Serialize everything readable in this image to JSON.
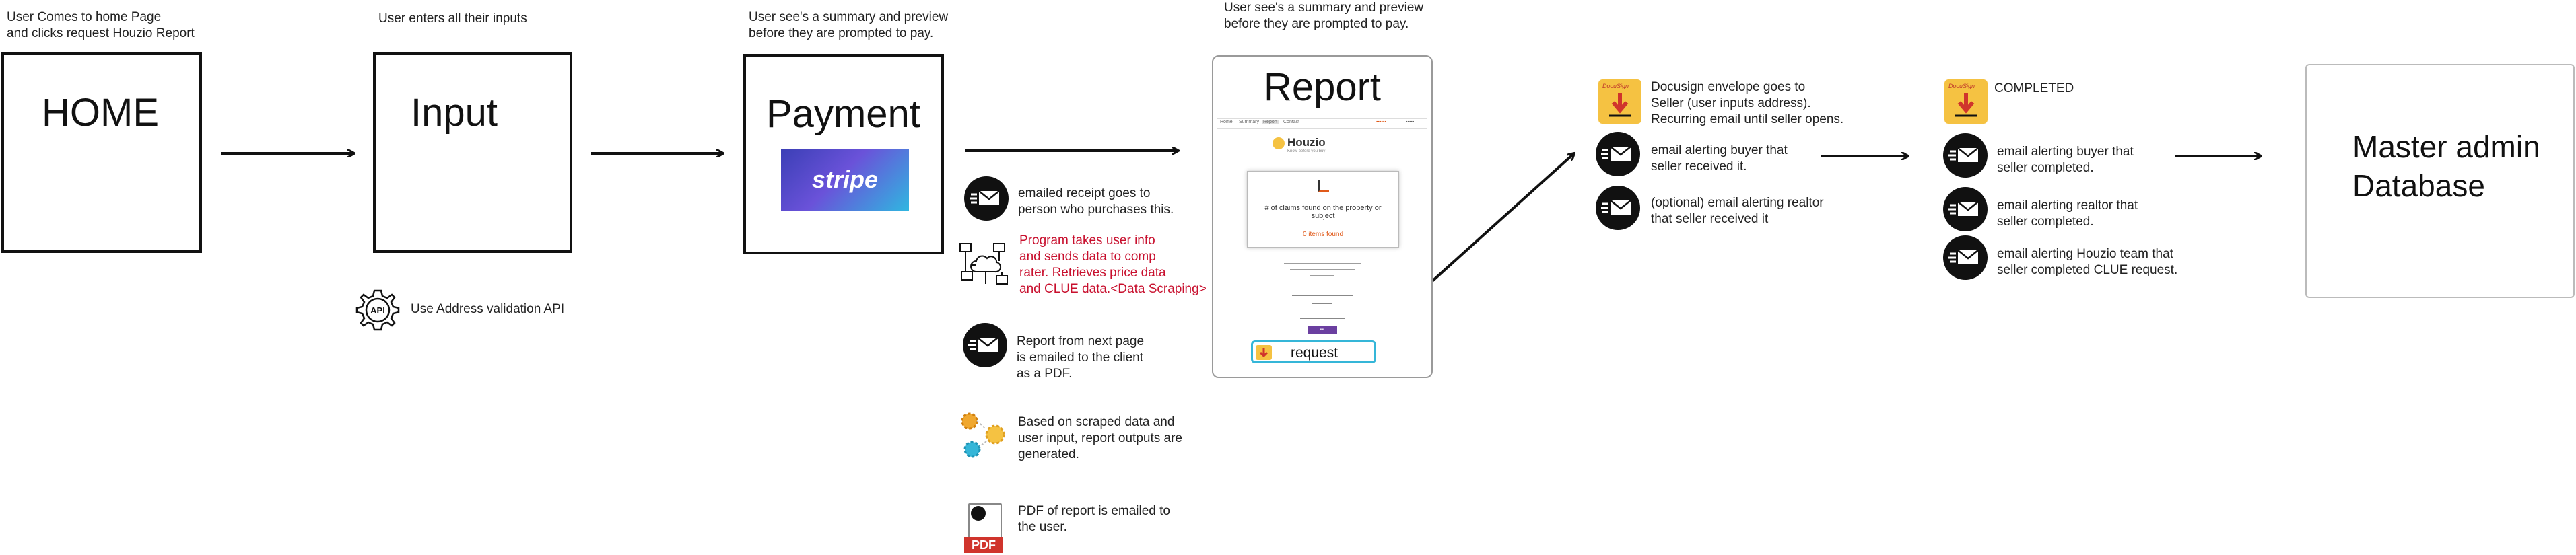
{
  "captions": {
    "home": "User Comes to home Page\nand clicks request Houzio Report",
    "input": "User enters all their inputs",
    "payment": "User see's a summary and preview\nbefore they are prompted to pay.",
    "report": "User see's a summary and preview\nbefore they are prompted to pay."
  },
  "boxes": {
    "home": "HOME",
    "input": "Input",
    "payment": "Payment",
    "stripe": "stripe",
    "master": "Master admin\nDatabase"
  },
  "api": {
    "icon_text": "API",
    "label": "Use Address validation API"
  },
  "payment_steps": {
    "receipt": "emailed receipt goes to\nperson who purchases this.",
    "scraping": "Program takes user info\nand sends data to comp\nrater. Retrieves price data\nand CLUE data.<Data Scraping>",
    "report_pdf": "Report from next page\nis emailed to the client\nas a PDF.",
    "generated": "Based on scraped data and\nuser input, report outputs are\ngenerated.",
    "pdf_email": "PDF of report is emailed to\nthe user.",
    "pdf_badge": "PDF"
  },
  "report_preview": {
    "title": "Report",
    "nav": [
      "Home",
      "Summary",
      "Report",
      "Contact"
    ],
    "logo": "Houzio",
    "logo_sub": "Know before you buy",
    "card_text": "# of claims found on the property or subject",
    "card_count": "0 items found",
    "request_label": "request"
  },
  "docusign_steps": {
    "badge": "DocuSign",
    "envelope": "Docusign  envelope goes to\nSeller (user inputs address).\nRecurring email until seller opens.",
    "buyer_received": "email alerting buyer that\nseller received it.",
    "realtor_received": "(optional) email alerting realtor\nthat seller received it"
  },
  "completed_steps": {
    "badge": "DocuSign",
    "title": "COMPLETED",
    "buyer": "email alerting buyer that\nseller completed.",
    "realtor": "email alerting realtor that\nseller completed.",
    "team": "email alerting Houzio team that\nseller completed CLUE request."
  },
  "colors": {
    "text": "#111111",
    "red_note": "#c8102e",
    "stripe_bg": "#5b4fd6",
    "docusign_bg": "#f5c242",
    "request_border": "#35b6d8"
  }
}
